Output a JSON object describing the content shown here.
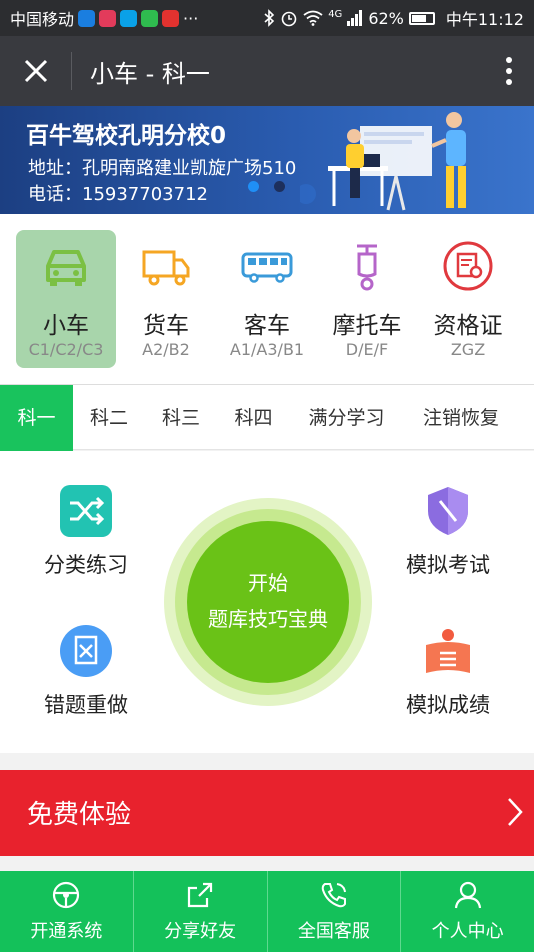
{
  "status_bar": {
    "carrier": "中国移动",
    "dots": "···",
    "network": "4G",
    "battery": "62%",
    "time": "中午11:12"
  },
  "title_bar": {
    "title": "小车 - 科一"
  },
  "banner": {
    "school": "百牛驾校孔明分校0",
    "address": "地址：孔明南路建业凯旋广场510",
    "phone": "电话：15937703712",
    "slide_count": 2,
    "active_slide": 1
  },
  "categories": [
    {
      "name": "小车",
      "code": "C1/C2/C3",
      "icon": "car-icon",
      "active": true
    },
    {
      "name": "货车",
      "code": "A2/B2",
      "icon": "truck-icon",
      "active": false
    },
    {
      "name": "客车",
      "code": "A1/A3/B1",
      "icon": "bus-icon",
      "active": false
    },
    {
      "name": "摩托车",
      "code": "D/E/F",
      "icon": "scooter-icon",
      "active": false
    },
    {
      "name": "资格证",
      "code": "ZGZ",
      "icon": "certificate-icon",
      "active": false
    }
  ],
  "tabs": [
    {
      "label": "科一",
      "active": true
    },
    {
      "label": "科二"
    },
    {
      "label": "科三"
    },
    {
      "label": "科四"
    },
    {
      "label": "满分学习"
    },
    {
      "label": "注销恢复"
    }
  ],
  "practice": {
    "category_practice": "分类练习",
    "mock_exam": "模拟考试",
    "redo_wrong": "错题重做",
    "mock_score": "模拟成绩",
    "center_line1": "开始",
    "center_line2": "题库技巧宝典"
  },
  "trial": {
    "label": "免费体验"
  },
  "bottom_nav": [
    {
      "label": "开通系统",
      "icon": "steering-wheel-icon"
    },
    {
      "label": "分享好友",
      "icon": "share-icon"
    },
    {
      "label": "全国客服",
      "icon": "phone-icon"
    },
    {
      "label": "个人中心",
      "icon": "user-icon"
    }
  ],
  "colors": {
    "primary_green": "#19c35d",
    "ball_green": "#6ac217",
    "trial_red": "#e8222d",
    "banner_blue": "#1c3f82"
  }
}
